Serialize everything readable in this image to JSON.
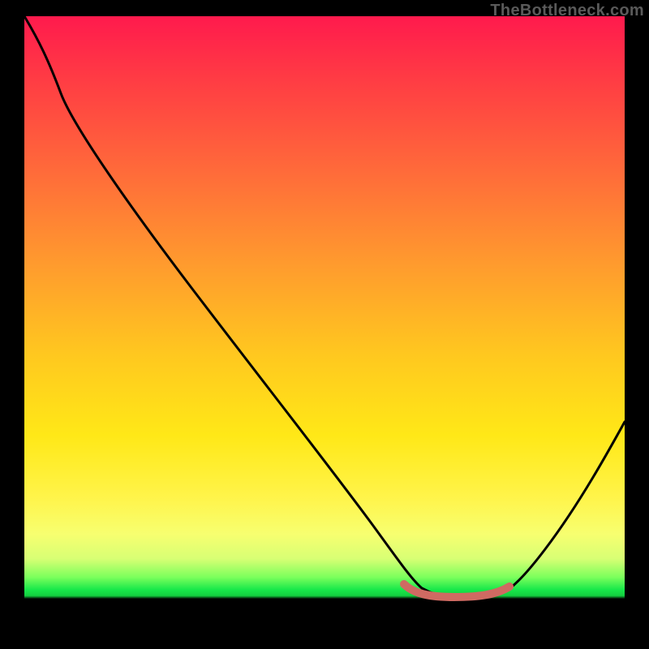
{
  "brand": "TheBottleneck.com",
  "colors": {
    "top": "#ff1a4d",
    "mid": "#ffc81f",
    "low": "#f7ff70",
    "green": "#18e84a",
    "black": "#000000",
    "trough_highlight": "#cf6a62",
    "curve": "#000000"
  },
  "chart_data": {
    "type": "line",
    "title": "",
    "xlabel": "",
    "ylabel": "",
    "xlim": [
      0,
      100
    ],
    "ylim": [
      0,
      100
    ],
    "series": [
      {
        "name": "bottleneck-curve",
        "x": [
          0,
          4,
          8,
          20,
          35,
          50,
          60,
          66,
          70,
          76,
          82,
          88,
          94,
          100
        ],
        "values": [
          100,
          96,
          88,
          74,
          55,
          36,
          18,
          6,
          2,
          2,
          6,
          18,
          34,
          52
        ]
      }
    ],
    "trough_segment": {
      "x_start": 63,
      "x_end": 80,
      "y": 2.5
    },
    "note": "Values are approximate, read off gradient position; y scales 0 at bottom to 100 at top."
  }
}
